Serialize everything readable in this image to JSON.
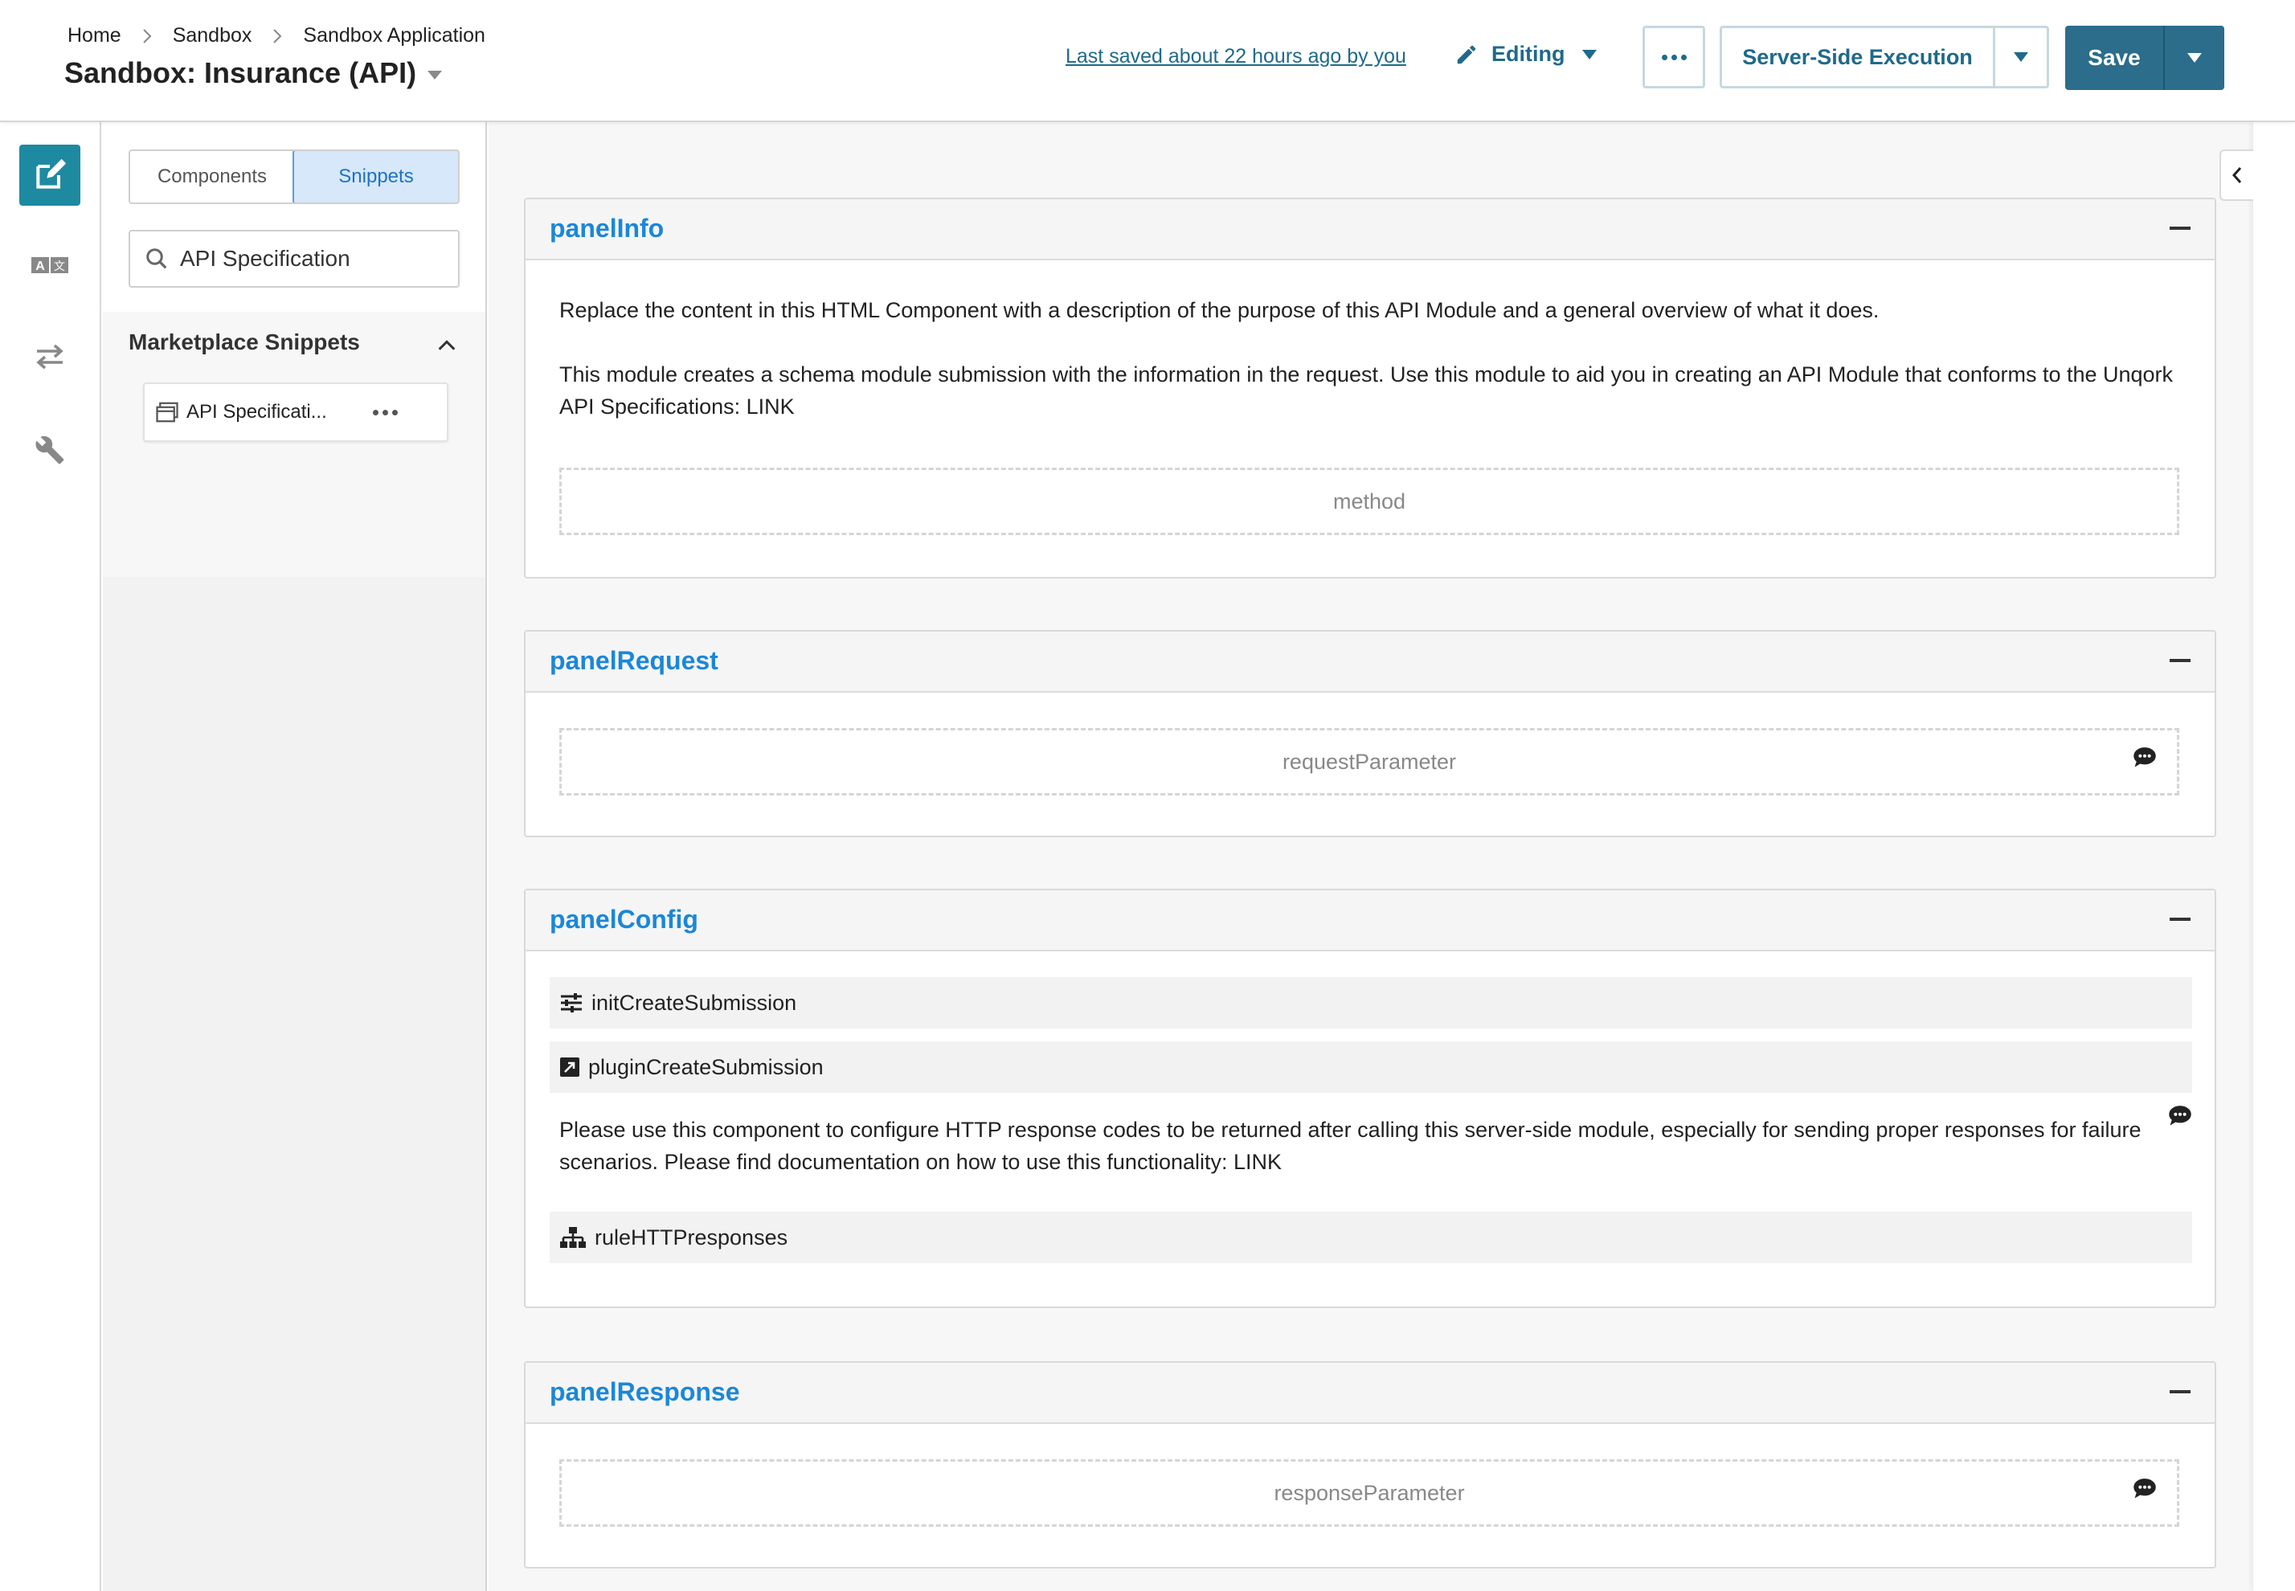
{
  "header": {
    "breadcrumb": [
      "Home",
      "Sandbox",
      "Sandbox Application"
    ],
    "title": "Sandbox: Insurance (API)",
    "last_saved": "Last saved about 22 hours ago by you",
    "mode_label": "Editing",
    "execution_label": "Server-Side Execution",
    "save_label": "Save"
  },
  "rail": {
    "items": [
      "edit-icon",
      "translate-icon",
      "transfer-icon",
      "wrench-icon"
    ],
    "active_index": 0,
    "accent_color": "#1d8aa2"
  },
  "sidebar": {
    "tabs": [
      "Components",
      "Snippets"
    ],
    "active_tab": "Snippets",
    "search_value": "API Specification",
    "section_title": "Marketplace Snippets",
    "snippet_label": "API Specificati..."
  },
  "panels": {
    "info": {
      "title": "panelInfo",
      "text1": "Replace the content in this HTML Component with a description of the purpose of this API Module and a general overview of what it does.",
      "text2": "This module creates a schema module submission with the information in the request. Use this module to aid you in creating an API Module that conforms to the Unqork API Specifications: LINK",
      "placeholder": "method"
    },
    "request": {
      "title": "panelRequest",
      "placeholder": "requestParameter"
    },
    "config": {
      "title": "panelConfig",
      "row1": "initCreateSubmission",
      "row2": "pluginCreateSubmission",
      "text": "Please use this component to configure HTTP response codes to be returned after calling this server-side module, especially for sending proper responses for failure scenarios. Please find documentation on how to use this functionality: LINK",
      "row3": "ruleHTTPresponses"
    },
    "response": {
      "title": "panelResponse",
      "placeholder": "responseParameter"
    }
  },
  "colors": {
    "primary": "#2b6d8a",
    "link": "#1b87d8",
    "active_tab_bg": "#d6e8f9"
  }
}
